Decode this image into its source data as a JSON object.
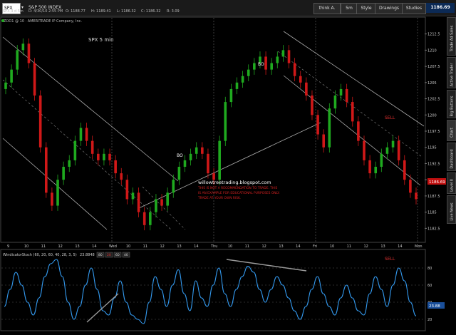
{
  "toolbar": {
    "symbol": "SPX",
    "symbol_desc": "S&P 500 INDEX",
    "quote_line": "SPX 3 d 5m",
    "date_time": "D: 4/30/10 2:55 PM",
    "open": "O: 1188.77",
    "high": "H: 1189.41",
    "low": "L: 1186.32",
    "close": "C: 1186.32",
    "range": "R: 3.09",
    "account": "think A.",
    "interval": "5m",
    "style_label": "Style",
    "drawings_label": "Drawings",
    "studies_label": "Studies",
    "last_price": "1186.69",
    "feed_line": "ZOO1 @ 10 · AMERITRADE IP Company, Inc."
  },
  "side_tabs": [
    "Trade Ad Sales",
    "Active Trader",
    "Big Buttons",
    "Chart",
    "Dashboard",
    "Level II",
    "Live News"
  ],
  "price_panel": {
    "label": "SPX 5 min",
    "watermark": "willowtreetrading.blogspot.com",
    "disclaimer": [
      "THIS IS NOT A RECOMMENDATION TO TRADE. THIS",
      "IS AN EXAMPLE FOR EDUCATIONAL PURPOSES ONLY.",
      "TRADE AT YOUR OWN RISK."
    ],
    "annotations": [
      "BO",
      "BO",
      "SELL"
    ],
    "y_ticks": [
      "1212.5",
      "1210",
      "1207.5",
      "1205",
      "1202.5",
      "1200",
      "1197.5",
      "1195",
      "1192.5",
      "1190",
      "1187.5",
      "1185",
      "1182.5"
    ],
    "x_ticks": [
      "9",
      "10",
      "11",
      "12",
      "13",
      "14",
      "Wed",
      "10",
      "11",
      "12",
      "13",
      "14",
      "Thu",
      "10",
      "11",
      "12",
      "13",
      "14",
      "Fri",
      "10",
      "11",
      "12",
      "13",
      "14",
      "Mon"
    ],
    "current_tag": "1186.69"
  },
  "osc_panel": {
    "title": "WindicatorStoch (60, 20, 60, 40, 28, 3, 5)",
    "value": "23.8848",
    "levels": [
      "80",
      "20",
      "60",
      "40"
    ],
    "annotation": "SELL",
    "y_ticks": [
      "80",
      "60",
      "40",
      "20"
    ],
    "current_tag": "23.88"
  },
  "colors": {
    "up": "#1faa1f",
    "down": "#d01818",
    "osc_line": "#3399ee",
    "background": "#000000"
  },
  "chart_data": [
    {
      "type": "candlestick",
      "title": "SPX 5 min",
      "ylim": [
        1181,
        1214
      ],
      "series": [
        {
          "name": "SPX",
          "values": [
            1205,
            1207,
            1210,
            1211,
            1208,
            1203,
            1195,
            1188,
            1186,
            1190,
            1192,
            1193,
            1196,
            1198,
            1196,
            1194,
            1193,
            1194,
            1193,
            1191,
            1190,
            1187,
            1188,
            1185,
            1183,
            1185,
            1187,
            1186,
            1188,
            1190,
            1192,
            1193,
            1194,
            1195,
            1194,
            1191,
            1190,
            1196,
            1202,
            1204,
            1205,
            1206,
            1207,
            1208,
            1209,
            1207,
            1208,
            1209,
            1210,
            1208,
            1206,
            1205,
            1203,
            1200,
            1197,
            1195,
            1201,
            1203,
            1204,
            1202,
            1199,
            1196,
            1193,
            1191,
            1192,
            1194,
            1195,
            1196,
            1193,
            1190,
            1188,
            1187
          ]
        }
      ]
    },
    {
      "type": "line",
      "title": "WindicatorStoch (60, 20, 60, 40, 28, 3, 5)",
      "ylim": [
        10,
        90
      ],
      "series": [
        {
          "name": "WindicatorStoch",
          "values": [
            35,
            55,
            75,
            60,
            40,
            25,
            45,
            70,
            85,
            90,
            70,
            40,
            20,
            35,
            60,
            80,
            55,
            30,
            25,
            45,
            65,
            40,
            25,
            20,
            15,
            40,
            70,
            55,
            35,
            60,
            78,
            50,
            30,
            65,
            45,
            35,
            60,
            80,
            50,
            35,
            55,
            70,
            82,
            75,
            55,
            40,
            55,
            70,
            60,
            45,
            30,
            20,
            35,
            55,
            70,
            50,
            35,
            25,
            45,
            60,
            45,
            30,
            25,
            50,
            70,
            55,
            35,
            60,
            80,
            65,
            40,
            24
          ]
        }
      ]
    }
  ]
}
